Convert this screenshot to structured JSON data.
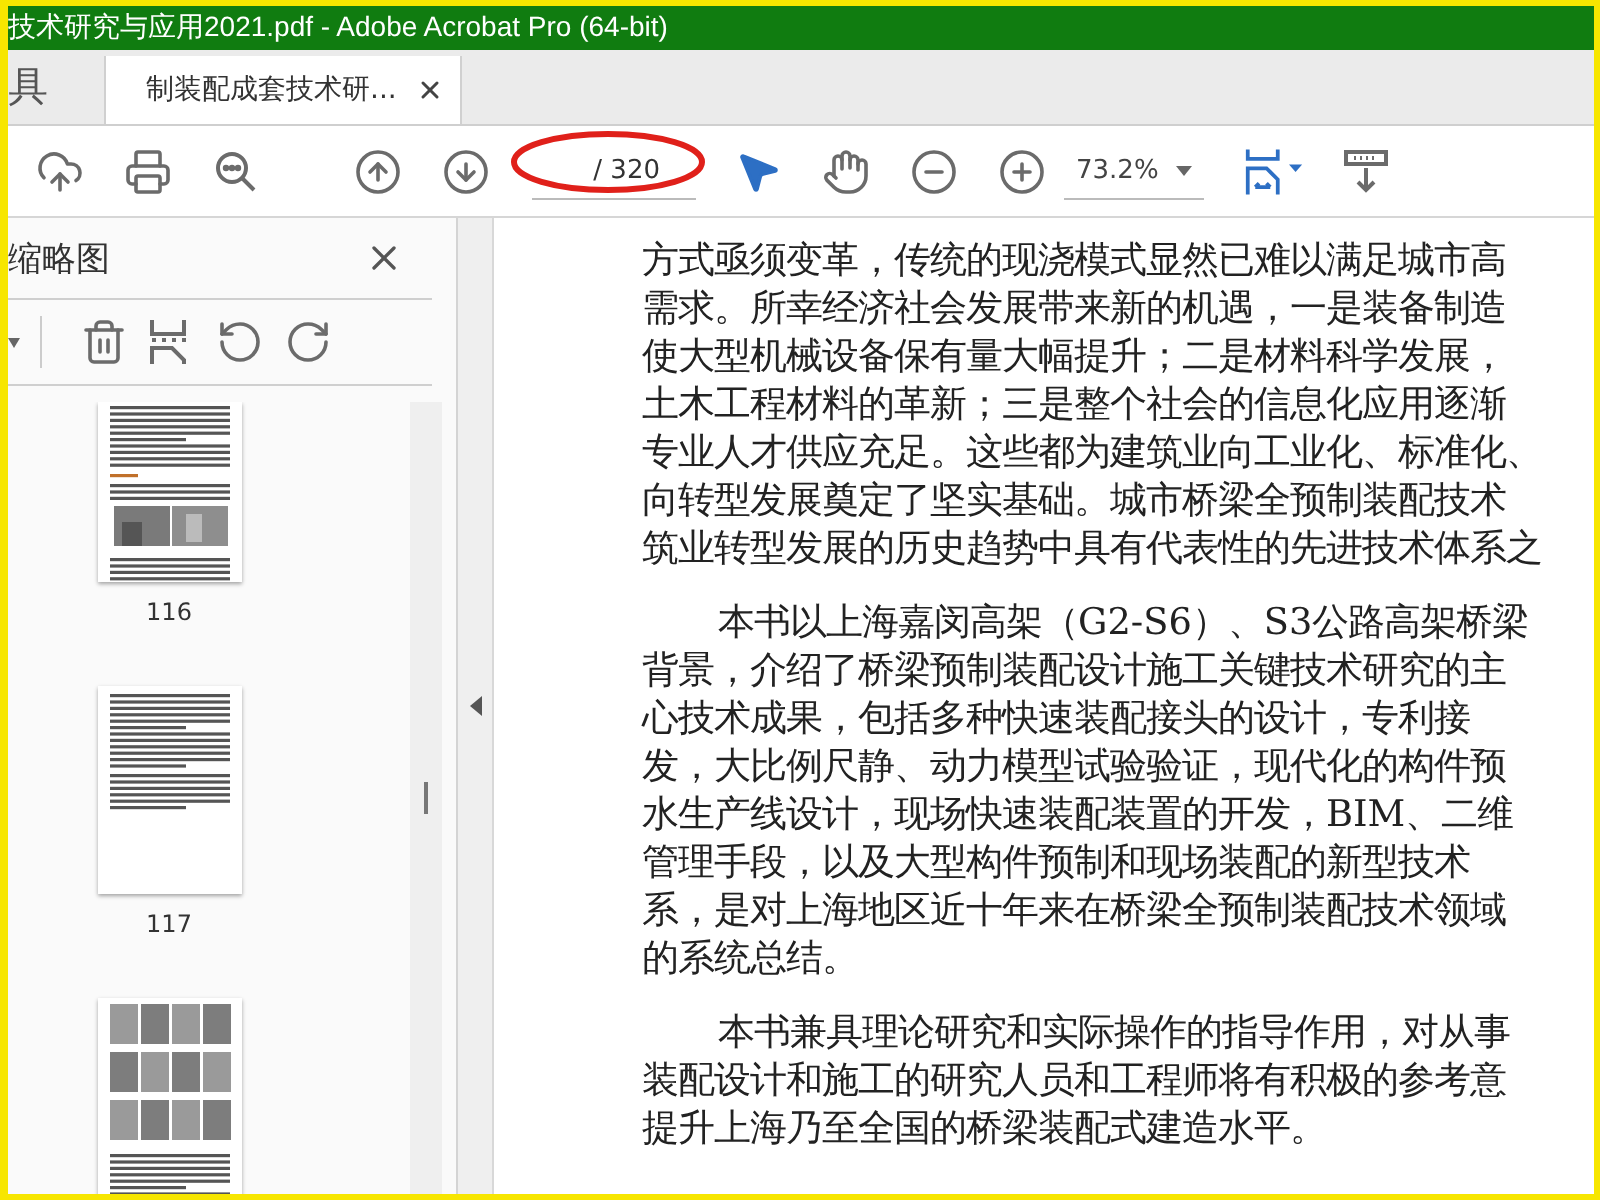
{
  "window": {
    "title": "技术研究与应用2021.pdf - Adobe Acrobat Pro (64-bit)"
  },
  "tabs": [
    {
      "label": "具",
      "selected": false
    },
    {
      "label": "制装配成套技术研...",
      "selected": true
    }
  ],
  "toolbar": {
    "page_total": "/ 320",
    "zoom": "73.2%",
    "tools": [
      {
        "kind": "select",
        "selected": true
      },
      {
        "kind": "hand",
        "selected": false
      }
    ]
  },
  "sidebar": {
    "title": "缩略图",
    "thumbnails": [
      {
        "kind": "text-photo",
        "page": "116"
      },
      {
        "kind": "text",
        "page": "117"
      },
      {
        "kind": "photos"
      }
    ]
  },
  "document": {
    "paragraphs": [
      {
        "indented": false,
        "lines": [
          "方式亟须变革，传统的现浇模式显然已难以满足城市高",
          "需求。所幸经济社会发展带来新的机遇，一是装备制造",
          "使大型机械设备保有量大幅提升；二是材料科学发展，",
          "土木工程材料的革新；三是整个社会的信息化应用逐渐",
          "专业人才供应充足。这些都为建筑业向工业化、标准化、",
          "向转型发展奠定了坚实基础。城市桥梁全预制装配技术",
          "筑业转型发展的历史趋势中具有代表性的先进技术体系之"
        ]
      },
      {
        "indented": true,
        "lines": [
          "本书以上海嘉闵高架（G2-S6）、S3公路高架桥梁",
          "背景，介绍了桥梁预制装配设计施工关键技术研究的主",
          "心技术成果，包括多种快速装配接头的设计，专利接",
          "发，大比例尺静、动力模型试验验证，现代化的构件预",
          "水生产线设计，现场快速装配装置的开发，BIM、二维",
          "管理手段，以及大型构件预制和现场装配的新型技术",
          "系，是对上海地区近十年来在桥梁全预制装配技术领域",
          "的系统总结。"
        ]
      },
      {
        "indented": true,
        "lines": [
          "本书兼具理论研究和实际操作的指导作用，对从事",
          "装配设计和施工的研究人员和工程师将有积极的参考意",
          "提升上海乃至全国的桥梁装配式建造水平。"
        ]
      }
    ]
  }
}
